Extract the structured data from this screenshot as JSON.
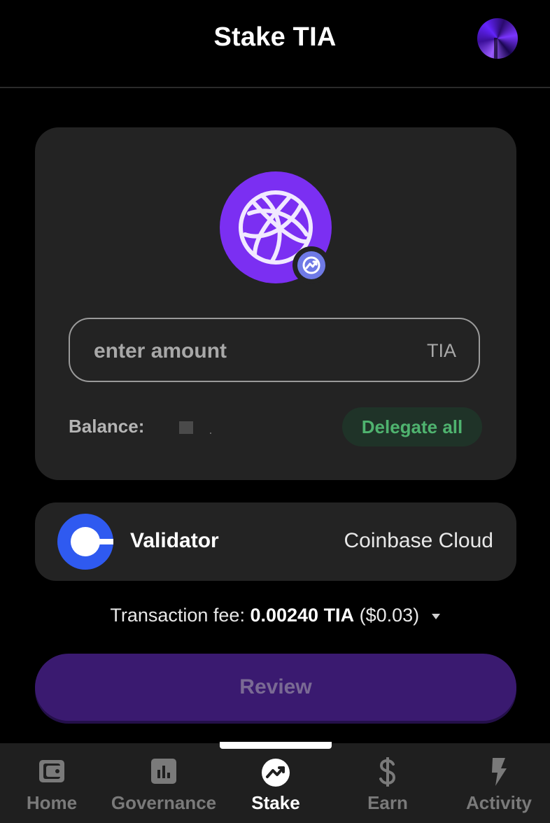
{
  "header": {
    "title": "Stake TIA"
  },
  "stake_form": {
    "amount_placeholder": "enter amount",
    "amount_unit": "TIA",
    "balance_label": "Balance:",
    "delegate_all_label": "Delegate all"
  },
  "validator": {
    "label": "Validator",
    "name": "Coinbase Cloud"
  },
  "fee": {
    "label": "Transaction fee:",
    "amount": "0.00240 TIA",
    "fiat": "($0.03)"
  },
  "review_label": "Review",
  "nav": {
    "items": [
      {
        "label": "Home",
        "icon": "wallet-icon",
        "active": false
      },
      {
        "label": "Governance",
        "icon": "bar-chart-icon",
        "active": false
      },
      {
        "label": "Stake",
        "icon": "stake-chart-icon",
        "active": true
      },
      {
        "label": "Earn",
        "icon": "dollar-icon",
        "active": false
      },
      {
        "label": "Activity",
        "icon": "lightning-icon",
        "active": false
      }
    ]
  },
  "colors": {
    "background": "#000000",
    "card": "#232323",
    "accent_purple": "#7b2ff2",
    "delegate_green": "#4fb36f",
    "review_button": "#3a1a70",
    "validator_blue": "#2f5af0"
  }
}
